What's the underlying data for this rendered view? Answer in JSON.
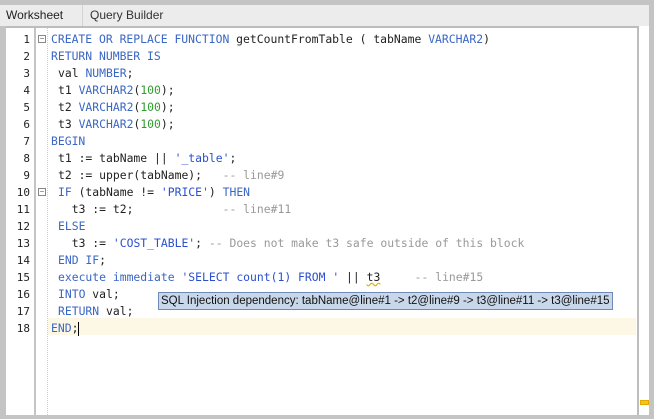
{
  "tabs": [
    {
      "label": "Worksheet",
      "active": true
    },
    {
      "label": "Query Builder",
      "active": false
    }
  ],
  "lines": [
    [
      [
        "kw",
        "CREATE OR REPLACE FUNCTION "
      ],
      [
        "",
        "getCountFromTable ( tabName "
      ],
      [
        "kw",
        "VARCHAR2"
      ],
      [
        "",
        ")"
      ]
    ],
    [
      [
        "kw",
        "RETURN NUMBER IS"
      ]
    ],
    [
      [
        "",
        ""
      ],
      [
        "",
        "val "
      ],
      [
        "kw",
        "NUMBER"
      ],
      [
        "",
        ";"
      ]
    ],
    [
      [
        "",
        "t1 "
      ],
      [
        "kw",
        "VARCHAR2"
      ],
      [
        "",
        "("
      ],
      [
        "num",
        "100"
      ],
      [
        "",
        ");"
      ]
    ],
    [
      [
        "",
        "t2 "
      ],
      [
        "kw",
        "VARCHAR2"
      ],
      [
        "",
        "("
      ],
      [
        "num",
        "100"
      ],
      [
        "",
        ");"
      ]
    ],
    [
      [
        "",
        "t3 "
      ],
      [
        "kw",
        "VARCHAR2"
      ],
      [
        "",
        "("
      ],
      [
        "num",
        "100"
      ],
      [
        "",
        ");"
      ]
    ],
    [
      [
        "kw",
        "BEGIN"
      ]
    ],
    [
      [
        "",
        "t1 := tabName || "
      ],
      [
        "str",
        "'_table'"
      ],
      [
        "",
        ";"
      ]
    ],
    [
      [
        "",
        "t2 := upper(tabName);   "
      ],
      [
        "cm",
        "-- line#9"
      ]
    ],
    [
      [
        "kw",
        "IF "
      ],
      [
        "",
        "(tabName != "
      ],
      [
        "str",
        "'PRICE'"
      ],
      [
        "",
        ") "
      ],
      [
        "kw",
        "THEN"
      ]
    ],
    [
      [
        "",
        "  t3 := t2;             "
      ],
      [
        "cm",
        "-- line#11"
      ]
    ],
    [
      [
        "kw",
        "ELSE"
      ]
    ],
    [
      [
        "",
        "  t3 := "
      ],
      [
        "str",
        "'COST_TABLE'"
      ],
      [
        "",
        "; "
      ],
      [
        "cm",
        "-- Does not make t3 safe outside of this block"
      ]
    ],
    [
      [
        "kw",
        "END IF"
      ],
      [
        "",
        ";"
      ]
    ],
    [
      [
        "kw",
        "execute immediate "
      ],
      [
        "str",
        "'SELECT count(1) FROM '"
      ],
      [
        "",
        " || "
      ],
      [
        "warn",
        "t3"
      ],
      [
        "",
        "     "
      ],
      [
        "cm",
        "-- line#15"
      ]
    ],
    [
      [
        "kw",
        "INTO "
      ],
      [
        "",
        "val;"
      ]
    ],
    [
      [
        "kw",
        "RETURN "
      ],
      [
        "",
        "val;"
      ]
    ],
    [
      [
        "kw",
        "END"
      ],
      [
        "",
        ";"
      ]
    ]
  ],
  "indent": [
    0,
    0,
    1,
    1,
    1,
    1,
    0,
    1,
    1,
    1,
    1,
    1,
    1,
    1,
    1,
    1,
    1,
    0
  ],
  "folds": [
    1,
    10
  ],
  "tooltip": "SQL Injection dependency: tabName@line#1 -> t2@line#9 -> t3@line#11 -> t3@line#15"
}
